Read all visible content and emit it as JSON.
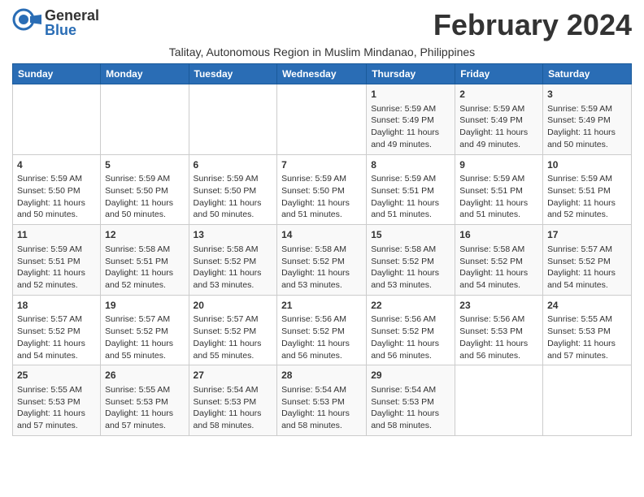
{
  "logo": {
    "general": "General",
    "blue": "Blue"
  },
  "title": "February 2024",
  "subtitle": "Talitay, Autonomous Region in Muslim Mindanao, Philippines",
  "days_of_week": [
    "Sunday",
    "Monday",
    "Tuesday",
    "Wednesday",
    "Thursday",
    "Friday",
    "Saturday"
  ],
  "weeks": [
    [
      {
        "num": "",
        "sunrise": "",
        "sunset": "",
        "daylight": ""
      },
      {
        "num": "",
        "sunrise": "",
        "sunset": "",
        "daylight": ""
      },
      {
        "num": "",
        "sunrise": "",
        "sunset": "",
        "daylight": ""
      },
      {
        "num": "",
        "sunrise": "",
        "sunset": "",
        "daylight": ""
      },
      {
        "num": "1",
        "sunrise": "Sunrise: 5:59 AM",
        "sunset": "Sunset: 5:49 PM",
        "daylight": "Daylight: 11 hours and 49 minutes."
      },
      {
        "num": "2",
        "sunrise": "Sunrise: 5:59 AM",
        "sunset": "Sunset: 5:49 PM",
        "daylight": "Daylight: 11 hours and 49 minutes."
      },
      {
        "num": "3",
        "sunrise": "Sunrise: 5:59 AM",
        "sunset": "Sunset: 5:49 PM",
        "daylight": "Daylight: 11 hours and 50 minutes."
      }
    ],
    [
      {
        "num": "4",
        "sunrise": "Sunrise: 5:59 AM",
        "sunset": "Sunset: 5:50 PM",
        "daylight": "Daylight: 11 hours and 50 minutes."
      },
      {
        "num": "5",
        "sunrise": "Sunrise: 5:59 AM",
        "sunset": "Sunset: 5:50 PM",
        "daylight": "Daylight: 11 hours and 50 minutes."
      },
      {
        "num": "6",
        "sunrise": "Sunrise: 5:59 AM",
        "sunset": "Sunset: 5:50 PM",
        "daylight": "Daylight: 11 hours and 50 minutes."
      },
      {
        "num": "7",
        "sunrise": "Sunrise: 5:59 AM",
        "sunset": "Sunset: 5:50 PM",
        "daylight": "Daylight: 11 hours and 51 minutes."
      },
      {
        "num": "8",
        "sunrise": "Sunrise: 5:59 AM",
        "sunset": "Sunset: 5:51 PM",
        "daylight": "Daylight: 11 hours and 51 minutes."
      },
      {
        "num": "9",
        "sunrise": "Sunrise: 5:59 AM",
        "sunset": "Sunset: 5:51 PM",
        "daylight": "Daylight: 11 hours and 51 minutes."
      },
      {
        "num": "10",
        "sunrise": "Sunrise: 5:59 AM",
        "sunset": "Sunset: 5:51 PM",
        "daylight": "Daylight: 11 hours and 52 minutes."
      }
    ],
    [
      {
        "num": "11",
        "sunrise": "Sunrise: 5:59 AM",
        "sunset": "Sunset: 5:51 PM",
        "daylight": "Daylight: 11 hours and 52 minutes."
      },
      {
        "num": "12",
        "sunrise": "Sunrise: 5:58 AM",
        "sunset": "Sunset: 5:51 PM",
        "daylight": "Daylight: 11 hours and 52 minutes."
      },
      {
        "num": "13",
        "sunrise": "Sunrise: 5:58 AM",
        "sunset": "Sunset: 5:52 PM",
        "daylight": "Daylight: 11 hours and 53 minutes."
      },
      {
        "num": "14",
        "sunrise": "Sunrise: 5:58 AM",
        "sunset": "Sunset: 5:52 PM",
        "daylight": "Daylight: 11 hours and 53 minutes."
      },
      {
        "num": "15",
        "sunrise": "Sunrise: 5:58 AM",
        "sunset": "Sunset: 5:52 PM",
        "daylight": "Daylight: 11 hours and 53 minutes."
      },
      {
        "num": "16",
        "sunrise": "Sunrise: 5:58 AM",
        "sunset": "Sunset: 5:52 PM",
        "daylight": "Daylight: 11 hours and 54 minutes."
      },
      {
        "num": "17",
        "sunrise": "Sunrise: 5:57 AM",
        "sunset": "Sunset: 5:52 PM",
        "daylight": "Daylight: 11 hours and 54 minutes."
      }
    ],
    [
      {
        "num": "18",
        "sunrise": "Sunrise: 5:57 AM",
        "sunset": "Sunset: 5:52 PM",
        "daylight": "Daylight: 11 hours and 54 minutes."
      },
      {
        "num": "19",
        "sunrise": "Sunrise: 5:57 AM",
        "sunset": "Sunset: 5:52 PM",
        "daylight": "Daylight: 11 hours and 55 minutes."
      },
      {
        "num": "20",
        "sunrise": "Sunrise: 5:57 AM",
        "sunset": "Sunset: 5:52 PM",
        "daylight": "Daylight: 11 hours and 55 minutes."
      },
      {
        "num": "21",
        "sunrise": "Sunrise: 5:56 AM",
        "sunset": "Sunset: 5:52 PM",
        "daylight": "Daylight: 11 hours and 56 minutes."
      },
      {
        "num": "22",
        "sunrise": "Sunrise: 5:56 AM",
        "sunset": "Sunset: 5:52 PM",
        "daylight": "Daylight: 11 hours and 56 minutes."
      },
      {
        "num": "23",
        "sunrise": "Sunrise: 5:56 AM",
        "sunset": "Sunset: 5:53 PM",
        "daylight": "Daylight: 11 hours and 56 minutes."
      },
      {
        "num": "24",
        "sunrise": "Sunrise: 5:55 AM",
        "sunset": "Sunset: 5:53 PM",
        "daylight": "Daylight: 11 hours and 57 minutes."
      }
    ],
    [
      {
        "num": "25",
        "sunrise": "Sunrise: 5:55 AM",
        "sunset": "Sunset: 5:53 PM",
        "daylight": "Daylight: 11 hours and 57 minutes."
      },
      {
        "num": "26",
        "sunrise": "Sunrise: 5:55 AM",
        "sunset": "Sunset: 5:53 PM",
        "daylight": "Daylight: 11 hours and 57 minutes."
      },
      {
        "num": "27",
        "sunrise": "Sunrise: 5:54 AM",
        "sunset": "Sunset: 5:53 PM",
        "daylight": "Daylight: 11 hours and 58 minutes."
      },
      {
        "num": "28",
        "sunrise": "Sunrise: 5:54 AM",
        "sunset": "Sunset: 5:53 PM",
        "daylight": "Daylight: 11 hours and 58 minutes."
      },
      {
        "num": "29",
        "sunrise": "Sunrise: 5:54 AM",
        "sunset": "Sunset: 5:53 PM",
        "daylight": "Daylight: 11 hours and 58 minutes."
      },
      {
        "num": "",
        "sunrise": "",
        "sunset": "",
        "daylight": ""
      },
      {
        "num": "",
        "sunrise": "",
        "sunset": "",
        "daylight": ""
      }
    ]
  ]
}
